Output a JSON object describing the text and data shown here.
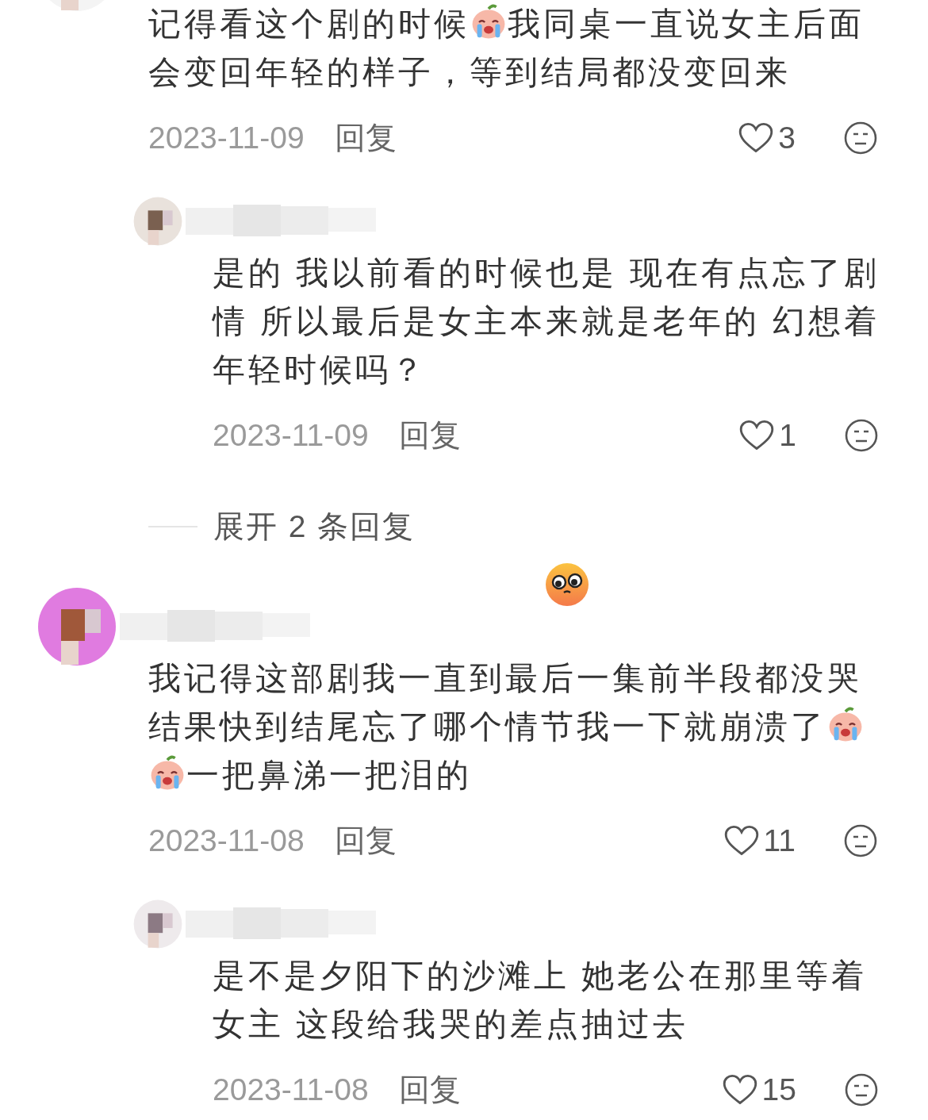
{
  "thread": [
    {
      "kind": "comment",
      "parts": [
        {
          "kind": "text",
          "text": "记得看这个剧的时候"
        },
        {
          "kind": "sticker"
        },
        {
          "kind": "text",
          "text": "我同桌一直说女主后面会变回年轻的样子，等到结局都没变回来"
        }
      ],
      "date": "2023-11-09",
      "reply": "回复",
      "likes": "3"
    },
    {
      "kind": "reply",
      "parts": [
        {
          "kind": "text",
          "text": "是的 我以前看的时候也是 现在有点忘了剧情 所以最后是女主本来就是老年的 幻想着年轻时候吗？"
        }
      ],
      "date": "2023-11-09",
      "reply": "回复",
      "likes": "1"
    },
    {
      "kind": "expand",
      "text": "展开 2 条回复"
    },
    {
      "kind": "emoji"
    },
    {
      "kind": "comment",
      "parts": [
        {
          "kind": "text",
          "text": "我记得这部剧我一直到最后一集前半段都没哭结果快到结尾忘了哪个情节我一下就崩溃了"
        },
        {
          "kind": "sticker"
        },
        {
          "kind": "sticker"
        },
        {
          "kind": "text",
          "text": "一把鼻涕一把泪的"
        }
      ],
      "date": "2023-11-08",
      "reply": "回复",
      "likes": "11"
    },
    {
      "kind": "reply",
      "parts": [
        {
          "kind": "text",
          "text": "是不是夕阳下的沙滩上 她老公在那里等着女主 这段给我哭的差点抽过去"
        }
      ],
      "date": "2023-11-08",
      "reply": "回复",
      "likes": "15"
    }
  ]
}
